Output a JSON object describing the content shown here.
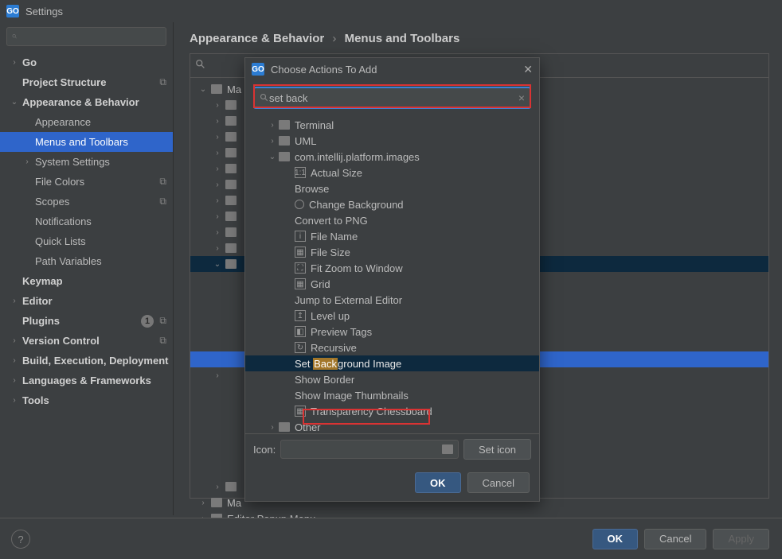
{
  "window": {
    "title": "Settings",
    "app_icon_text": "GO"
  },
  "breadcrumb": {
    "a": "Appearance & Behavior",
    "b": "Menus and Toolbars"
  },
  "sidebar_search_placeholder": "",
  "sidebar": [
    {
      "label": "Go",
      "bold": true,
      "depth": 0,
      "chev": "›"
    },
    {
      "label": "Project Structure",
      "bold": true,
      "depth": 0,
      "right": "⧉"
    },
    {
      "label": "Appearance & Behavior",
      "bold": true,
      "depth": 0,
      "chev": "⌄"
    },
    {
      "label": "Appearance",
      "depth": 1
    },
    {
      "label": "Menus and Toolbars",
      "depth": 1,
      "selected": true
    },
    {
      "label": "System Settings",
      "depth": 1,
      "chev": "›"
    },
    {
      "label": "File Colors",
      "depth": 1,
      "right": "⧉"
    },
    {
      "label": "Scopes",
      "depth": 1,
      "right": "⧉"
    },
    {
      "label": "Notifications",
      "depth": 1
    },
    {
      "label": "Quick Lists",
      "depth": 1
    },
    {
      "label": "Path Variables",
      "depth": 1
    },
    {
      "label": "Keymap",
      "bold": true,
      "depth": 0
    },
    {
      "label": "Editor",
      "bold": true,
      "depth": 0,
      "chev": "›"
    },
    {
      "label": "Plugins",
      "bold": true,
      "depth": 0,
      "count": "1",
      "right": "⧉"
    },
    {
      "label": "Version Control",
      "bold": true,
      "depth": 0,
      "chev": "›",
      "right": "⧉"
    },
    {
      "label": "Build, Execution, Deployment",
      "bold": true,
      "depth": 0,
      "chev": "›"
    },
    {
      "label": "Languages & Frameworks",
      "bold": true,
      "depth": 0,
      "chev": "›"
    },
    {
      "label": "Tools",
      "bold": true,
      "depth": 0,
      "chev": "›"
    }
  ],
  "menus_tree": [
    {
      "label": "Ma",
      "depth": 0,
      "chev": "⌄",
      "folder": true
    },
    {
      "label": "",
      "depth": 1,
      "chev": "›",
      "folder": true
    },
    {
      "label": "",
      "depth": 1,
      "chev": "›",
      "folder": true
    },
    {
      "label": "",
      "depth": 1,
      "chev": "›",
      "folder": true
    },
    {
      "label": "",
      "depth": 1,
      "chev": "›",
      "folder": true
    },
    {
      "label": "",
      "depth": 1,
      "chev": "›",
      "folder": true
    },
    {
      "label": "",
      "depth": 1,
      "chev": "›",
      "folder": true
    },
    {
      "label": "",
      "depth": 1,
      "chev": "›",
      "folder": true
    },
    {
      "label": "",
      "depth": 1,
      "chev": "›",
      "folder": true
    },
    {
      "label": "",
      "depth": 1,
      "chev": "›",
      "folder": true
    },
    {
      "label": "",
      "depth": 1,
      "chev": "›",
      "folder": true
    },
    {
      "label": "",
      "depth": 1,
      "chev": "⌄",
      "folder": true,
      "selinactive": true
    },
    {
      "label": "",
      "depth": 1
    },
    {
      "label": "",
      "depth": 1
    },
    {
      "label": "",
      "depth": 1
    },
    {
      "label": "",
      "depth": 1
    },
    {
      "label": "",
      "depth": 1
    },
    {
      "label": "",
      "depth": 1,
      "selrow": true
    },
    {
      "label": "",
      "depth": 1,
      "chev": "›"
    },
    {
      "label": "",
      "depth": 1
    },
    {
      "label": "",
      "depth": 1
    },
    {
      "label": "",
      "depth": 1
    },
    {
      "label": "",
      "depth": 1
    },
    {
      "label": "",
      "depth": 1
    },
    {
      "label": "",
      "depth": 1
    },
    {
      "label": "",
      "depth": 1,
      "chev": "›",
      "folder": true
    },
    {
      "label": "Ma",
      "depth": 0,
      "chev": "›",
      "folder": true
    },
    {
      "label": "Editor Popup Menu",
      "depth": 0,
      "chev": "›",
      "folder": true
    }
  ],
  "modal": {
    "title": "Choose Actions To Add",
    "app_icon_text": "GO",
    "search_value": "set back",
    "icon_label": "Icon:",
    "set_icon_btn": "Set icon",
    "ok": "OK",
    "cancel": "Cancel"
  },
  "actions": [
    {
      "label": "Terminal",
      "depth": 0,
      "chev": "›",
      "folder": true
    },
    {
      "label": "UML",
      "depth": 0,
      "chev": "›",
      "folder": true
    },
    {
      "label": "com.intellij.platform.images",
      "depth": 0,
      "chev": "⌄",
      "folder": true
    },
    {
      "label": "Actual Size",
      "depth": 1,
      "icon": "1:1"
    },
    {
      "label": "Browse",
      "depth": 1
    },
    {
      "label": "Change Background",
      "depth": 1,
      "radio": true
    },
    {
      "label": "Convert to PNG",
      "depth": 1
    },
    {
      "label": "File Name",
      "depth": 1,
      "icon": "i"
    },
    {
      "label": "File Size",
      "depth": 1,
      "icon": "▦"
    },
    {
      "label": "Fit Zoom to Window",
      "depth": 1,
      "icon": "⛶"
    },
    {
      "label": "Grid",
      "depth": 1,
      "icon": "▦"
    },
    {
      "label": "Jump to External Editor",
      "depth": 1
    },
    {
      "label": "Level up",
      "depth": 1,
      "icon": "↥"
    },
    {
      "label": "Preview Tags",
      "depth": 1,
      "icon": "◧"
    },
    {
      "label": "Recursive",
      "depth": 1,
      "icon": "↻"
    },
    {
      "label_pre": "Set ",
      "label_hl": "Back",
      "label_post": "ground Image",
      "depth": 1,
      "sel": true
    },
    {
      "label": "Show Border",
      "depth": 1
    },
    {
      "label": "Show Image Thumbnails",
      "depth": 1
    },
    {
      "label": "Transparency Chessboard",
      "depth": 1,
      "icon": "▦"
    },
    {
      "label": "Other",
      "depth": 0,
      "chev": "›",
      "folder": true,
      "other": true
    }
  ],
  "footer": {
    "ok": "OK",
    "cancel": "Cancel",
    "apply": "Apply",
    "help": "?"
  }
}
